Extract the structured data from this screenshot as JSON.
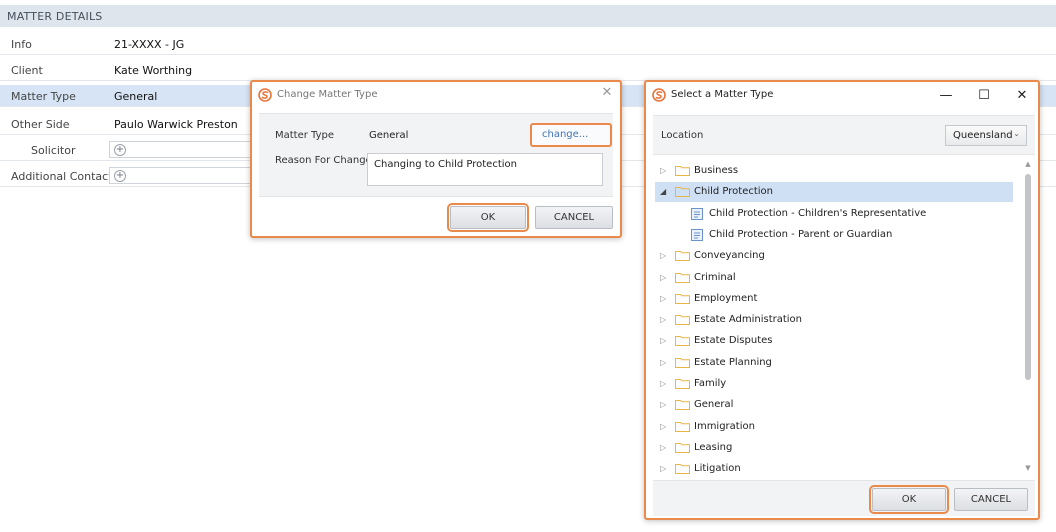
{
  "matter_details": {
    "header": "MATTER DETAILS",
    "rows": [
      {
        "label": "Info",
        "value": "21-XXXX - JG"
      },
      {
        "label": "Client",
        "value": "Kate Worthing"
      },
      {
        "label": "Matter Type",
        "value": "General"
      },
      {
        "label": "Other Side",
        "value": "Paulo Warwick Preston"
      },
      {
        "label": "Solicitor",
        "value": ""
      },
      {
        "label": "Additional Contact",
        "value": ""
      }
    ]
  },
  "change_dialog": {
    "title": "Change Matter Type",
    "matter_type_label": "Matter Type",
    "matter_type_value": "General",
    "change_link": "change...",
    "reason_label": "Reason For Change",
    "reason_value": "Changing to Child Protection",
    "ok_label": "OK",
    "cancel_label": "CANCEL",
    "close_glyph": "✕"
  },
  "select_dialog": {
    "title": "Select a Matter Type",
    "minimize_glyph": "—",
    "maximize_glyph": "☐",
    "close_glyph": "✕",
    "location_label": "Location",
    "location_value": "Queensland",
    "tree": [
      {
        "label": "Business",
        "kind": "folder",
        "expanded": false
      },
      {
        "label": "Child Protection",
        "kind": "folder",
        "expanded": true,
        "selected": true
      },
      {
        "label": "Child Protection - Children's Representative",
        "kind": "template"
      },
      {
        "label": "Child Protection - Parent or Guardian",
        "kind": "template"
      },
      {
        "label": "Conveyancing",
        "kind": "folder",
        "expanded": false
      },
      {
        "label": "Criminal",
        "kind": "folder",
        "expanded": false
      },
      {
        "label": "Employment",
        "kind": "folder",
        "expanded": false
      },
      {
        "label": "Estate Administration",
        "kind": "folder",
        "expanded": false
      },
      {
        "label": "Estate Disputes",
        "kind": "folder",
        "expanded": false
      },
      {
        "label": "Estate Planning",
        "kind": "folder",
        "expanded": false
      },
      {
        "label": "Family",
        "kind": "folder",
        "expanded": false
      },
      {
        "label": "General",
        "kind": "folder",
        "expanded": false
      },
      {
        "label": "Immigration",
        "kind": "folder",
        "expanded": false
      },
      {
        "label": "Leasing",
        "kind": "folder",
        "expanded": false
      },
      {
        "label": "Litigation",
        "kind": "folder",
        "expanded": false
      }
    ],
    "ok_label": "OK",
    "cancel_label": "CANCEL"
  },
  "colors": {
    "accent_highlight": "#e98a4c",
    "link_blue": "#3f73b5",
    "selected_row": "#d6e4f5",
    "folder_yellow": "#e8b54a",
    "logo_orange": "#e8743b"
  },
  "icons": {
    "app_logo": "app-logo-icon",
    "folder": "folder-icon",
    "template": "template-icon",
    "add": "add-circle-icon"
  }
}
